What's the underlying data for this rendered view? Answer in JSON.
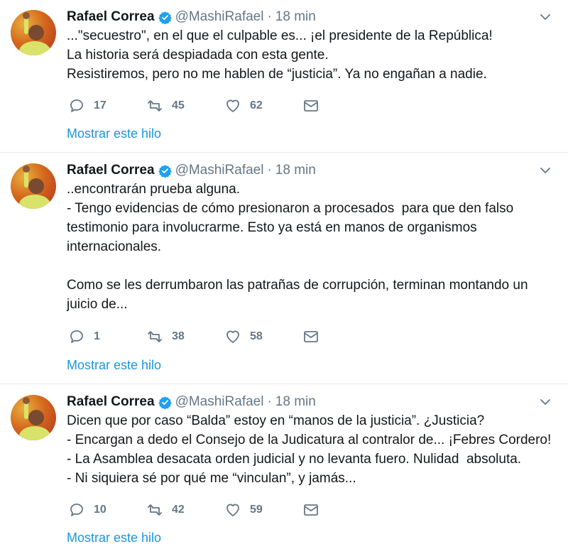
{
  "tweets": [
    {
      "name": "Rafael Correa",
      "handle": "@MashiRafael",
      "sep": "·",
      "time": "18 min",
      "text": "...\"secuestro\", en el que el culpable es... ¡el presidente de la República!\nLa historia será despiadada con esta gente.\nResistiremos, pero no me hablen de “justicia”. Ya no engañan a nadie.",
      "replies": "17",
      "retweets": "45",
      "likes": "62",
      "thread_link": "Mostrar este hilo"
    },
    {
      "name": "Rafael Correa",
      "handle": "@MashiRafael",
      "sep": "·",
      "time": "18 min",
      "text": "..encontrarán prueba alguna.\n- Tengo evidencias de cómo presionaron a procesados  para que den falso\ntestimonio para involucrarme. Esto ya está en manos de organismos\ninternacionales.\n\nComo se les derrumbaron las patrañas de corrupción, terminan montando un\njuicio de...",
      "replies": "1",
      "retweets": "38",
      "likes": "58",
      "thread_link": "Mostrar este hilo"
    },
    {
      "name": "Rafael Correa",
      "handle": "@MashiRafael",
      "sep": "·",
      "time": "18 min",
      "text": "Dicen que por caso “Balda” estoy en “manos de la justicia”. ¿Justicia?\n- Encargan a dedo el Consejo de la Judicatura al contralor de... ¡Febres Cordero!\n- La Asamblea desacata orden judicial y no levanta fuero. Nulidad  absoluta.\n- Ni siquiera sé por qué me “vinculan”, y jamás...",
      "replies": "10",
      "retweets": "42",
      "likes": "59",
      "thread_link": "Mostrar este hilo"
    }
  ],
  "icons": {
    "verified": "verified-badge-icon",
    "caret": "chevron-down-icon",
    "reply": "reply-icon",
    "retweet": "retweet-icon",
    "like": "heart-icon",
    "dm": "envelope-icon"
  },
  "colors": {
    "accent": "#1b95e0",
    "verified": "#1da1f2",
    "secondary_text": "#657786",
    "divider": "#e6ecf0"
  }
}
